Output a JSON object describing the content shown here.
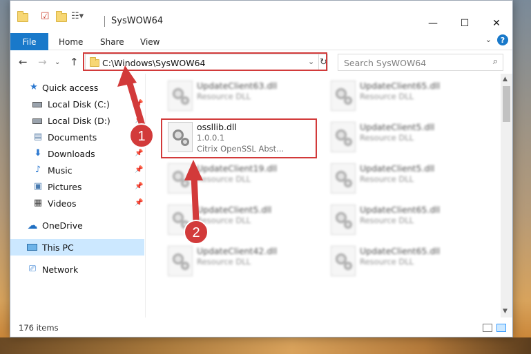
{
  "window": {
    "title": "SysWOW64",
    "controls": {
      "minimize": "—",
      "maximize": "☐",
      "close": "✕"
    }
  },
  "ribbon": {
    "tabs": [
      "File",
      "Home",
      "Share",
      "View"
    ],
    "help": "?"
  },
  "address": {
    "path": "C:\\Windows\\SysWOW64",
    "search_placeholder": "Search SysWOW64"
  },
  "sidebar": {
    "items": [
      {
        "label": "Quick access",
        "icon": "star-icon",
        "pinned": false
      },
      {
        "label": "Local Disk (C:)",
        "icon": "drive-icon",
        "pinned": true
      },
      {
        "label": "Local Disk (D:)",
        "icon": "drive-icon",
        "pinned": true
      },
      {
        "label": "Documents",
        "icon": "documents-icon",
        "pinned": true
      },
      {
        "label": "Downloads",
        "icon": "download-icon",
        "pinned": true
      },
      {
        "label": "Music",
        "icon": "music-icon",
        "pinned": true
      },
      {
        "label": "Pictures",
        "icon": "pictures-icon",
        "pinned": true
      },
      {
        "label": "Videos",
        "icon": "videos-icon",
        "pinned": true
      },
      {
        "label": "OneDrive",
        "icon": "cloud-icon",
        "pinned": false
      },
      {
        "label": "This PC",
        "icon": "computer-icon",
        "pinned": false,
        "selected": true
      },
      {
        "label": "Network",
        "icon": "network-icon",
        "pinned": false
      }
    ]
  },
  "files": [
    {
      "name": "UpdateClient63.dll",
      "type": "Resource DLL",
      "blurred": true
    },
    {
      "name": "UpdateClient65.dll",
      "type": "Resource DLL",
      "blurred": true
    },
    {
      "name": "ossllib.dll",
      "version": "1.0.0.1",
      "description": "Citrix OpenSSL Abst...",
      "blurred": false
    },
    {
      "name": "UpdateClient5.dll",
      "type": "Resource DLL",
      "blurred": true
    },
    {
      "name": "UpdateClient19.dll",
      "type": "Resource DLL",
      "blurred": true
    },
    {
      "name": "UpdateClient5.dll",
      "type": "Resource DLL",
      "blurred": true
    },
    {
      "name": "UpdateClient5.dll",
      "type": "Resource DLL",
      "blurred": true
    },
    {
      "name": "UpdateClient65.dll",
      "type": "Resource DLL",
      "blurred": true
    },
    {
      "name": "UpdateClient42.dll",
      "type": "Resource DLL",
      "blurred": true
    },
    {
      "name": "UpdateClient65.dll",
      "type": "Resource DLL",
      "blurred": true
    }
  ],
  "annotations": {
    "step1": "1",
    "step2": "2",
    "color": "#d23a3a"
  },
  "status": {
    "item_count": "176 items"
  }
}
